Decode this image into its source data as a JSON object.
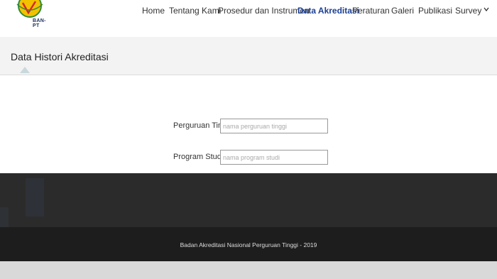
{
  "logo": {
    "text": "BAN-PT"
  },
  "nav": {
    "items": [
      {
        "label": "Home"
      },
      {
        "label": "Tentang Kami"
      },
      {
        "label": "Prosedur dan Instrumen"
      },
      {
        "label": "Data Akreditasi",
        "active": true
      },
      {
        "label": "Peraturan"
      },
      {
        "label": "Galeri"
      },
      {
        "label": "Publikasi"
      },
      {
        "label": "Survey"
      }
    ]
  },
  "page": {
    "title": "Data Histori Akreditasi"
  },
  "form": {
    "perguruan_tinggi": {
      "label": "Perguruan Tinggi",
      "placeholder": "nama perguruan tinggi",
      "value": ""
    },
    "program_studi": {
      "label": "Program Studi",
      "placeholder": "nama program studi",
      "value": ""
    }
  },
  "footer": {
    "text": "Badan Akreditasi Nasional Perguruan Tinggi - 2019"
  },
  "colors": {
    "nav_active": "#1c3f94",
    "footer_bg": "#1d1d1d",
    "band_bg": "#2b2b2b",
    "logo_yellow": "#f2c200",
    "logo_green": "#2e8b3a",
    "logo_red": "#d7262b"
  }
}
